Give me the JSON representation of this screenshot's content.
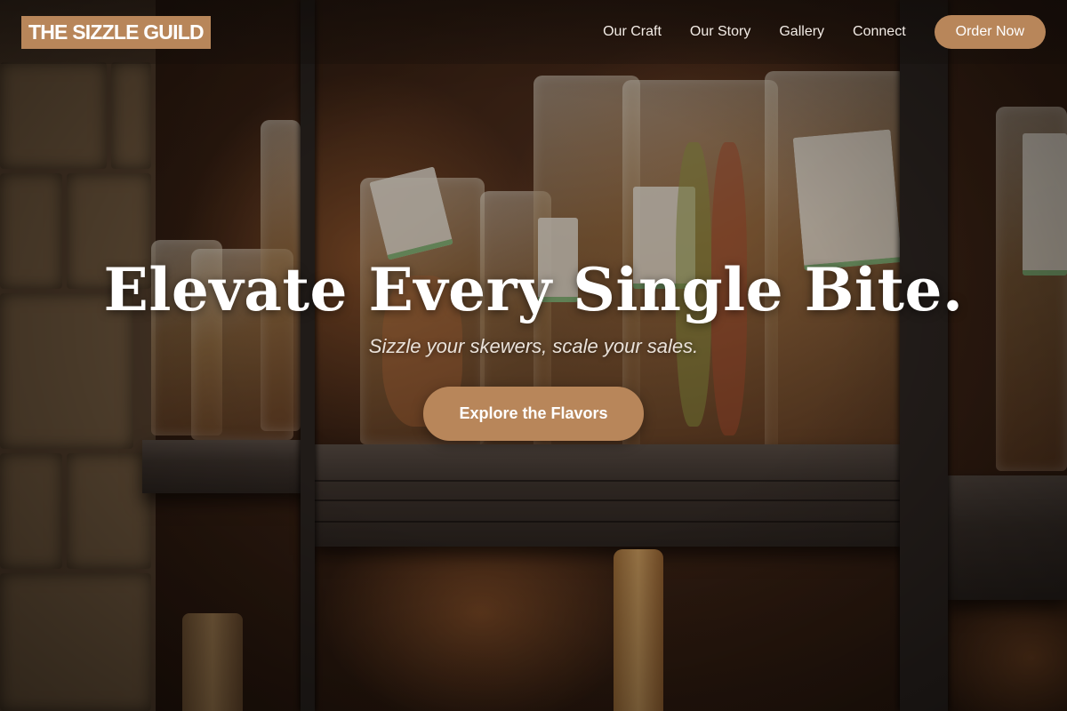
{
  "brand": {
    "logo_text": "THE SIZZLE GUILD"
  },
  "nav": {
    "links": [
      "Our Craft",
      "Our Story",
      "Gallery",
      "Connect"
    ],
    "order_label": "Order Now"
  },
  "hero": {
    "headline": "Elevate Every Single Bite.",
    "tagline": "Sizzle your skewers, scale your sales.",
    "cta_label": "Explore the Flavors"
  },
  "colors": {
    "accent": "#b8865a",
    "text_light": "#ffffff",
    "overlay": "#1d130d"
  },
  "background_image": {
    "subject": "pantry shelves with bagged pasta"
  }
}
